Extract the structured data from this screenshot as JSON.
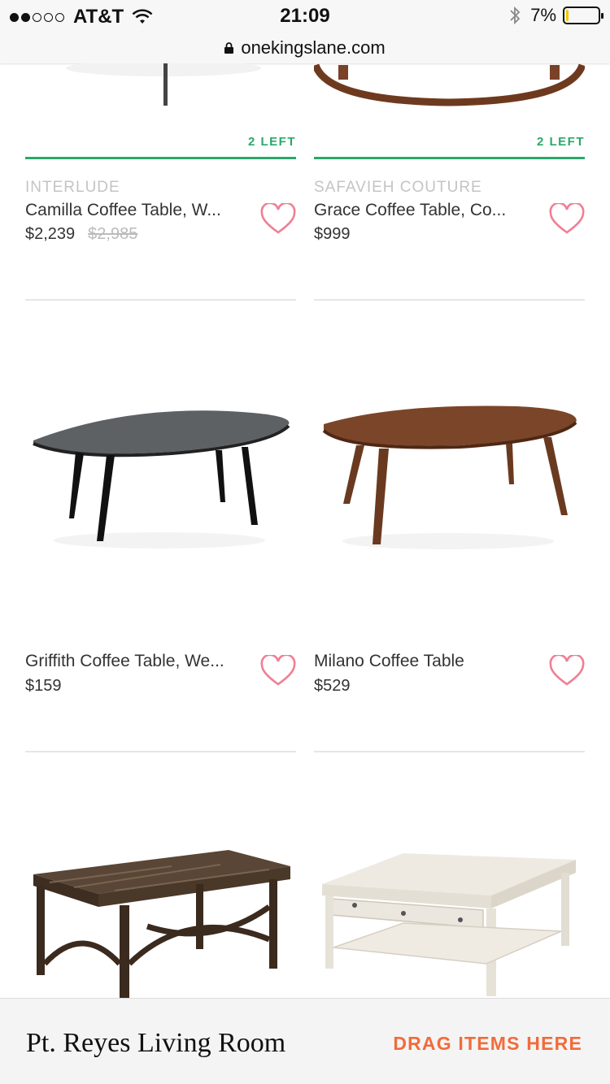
{
  "status_bar": {
    "carrier": "AT&T",
    "time": "21:09",
    "battery_percent": "7%",
    "battery_level": 0.07,
    "signal_dots": [
      true,
      true,
      false,
      false,
      false
    ],
    "icons": [
      "wifi-icon",
      "bluetooth-icon",
      "battery-icon"
    ]
  },
  "browser": {
    "domain": "onekingslane.com",
    "icon": "lock-icon"
  },
  "colors": {
    "accent_green": "#2aa86a",
    "heart_pink": "#f07f95",
    "drag_orange": "#f26b3a"
  },
  "products": [
    {
      "stock": "2 LEFT",
      "brand": "INTERLUDE",
      "title": "Camilla Coffee Table, W...",
      "price": "$2,239",
      "original_price": "$2,985",
      "icon": "heart-icon"
    },
    {
      "stock": "2 LEFT",
      "brand": "SAFAVIEH COUTURE",
      "title": "Grace Coffee Table, Co...",
      "price": "$999",
      "icon": "heart-icon"
    },
    {
      "title": "Griffith Coffee Table, We...",
      "price": "$159",
      "icon": "heart-icon"
    },
    {
      "title": "Milano Coffee Table",
      "price": "$529",
      "icon": "heart-icon"
    }
  ],
  "bottom_bar": {
    "room_name": "Pt. Reyes Living Room",
    "drag_label": "DRAG ITEMS HERE"
  }
}
